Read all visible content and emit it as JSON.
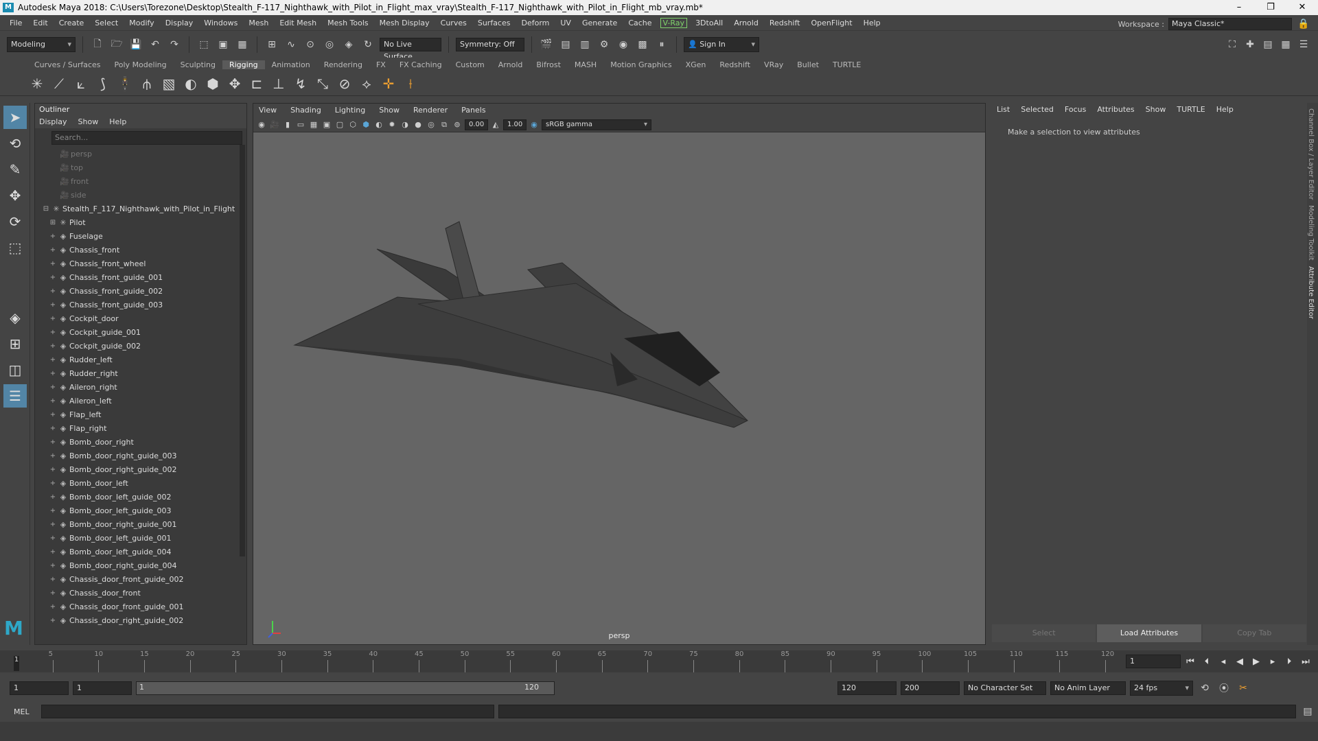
{
  "window": {
    "title": "Autodesk Maya 2018: C:\\Users\\Torezone\\Desktop\\Stealth_F-117_Nighthawk_with_Pilot_in_Flight_max_vray\\Stealth_F-117_Nighthawk_with_Pilot_in_Flight_mb_vray.mb*",
    "controls": [
      "–",
      "❐",
      "✕"
    ]
  },
  "menubar": [
    "File",
    "Edit",
    "Create",
    "Select",
    "Modify",
    "Display",
    "Windows",
    "Mesh",
    "Edit Mesh",
    "Mesh Tools",
    "Mesh Display",
    "Curves",
    "Surfaces",
    "Deform",
    "UV",
    "Generate",
    "Cache"
  ],
  "menubar_vray": "V-Ray",
  "menubar_tail": [
    "3DtoAll",
    "Arnold",
    "Redshift",
    "OpenFlight",
    "Help"
  ],
  "workspace": {
    "label": "Workspace :",
    "value": "Maya Classic*"
  },
  "statusline": {
    "mode": "Modeling",
    "live_surface": "No Live Surface",
    "symmetry": "Symmetry: Off",
    "sign_in": "Sign In"
  },
  "shelf_tabs": [
    "Curves / Surfaces",
    "Poly Modeling",
    "Sculpting",
    "Rigging",
    "Animation",
    "Rendering",
    "FX",
    "FX Caching",
    "Custom",
    "Arnold",
    "Bifrost",
    "MASH",
    "Motion Graphics",
    "XGen",
    "Redshift",
    "VRay",
    "Bullet",
    "TURTLE"
  ],
  "shelf_active": "Rigging",
  "outliner": {
    "title": "Outliner",
    "menu": [
      "Display",
      "Show",
      "Help"
    ],
    "search_placeholder": "Search...",
    "cameras": [
      "persp",
      "top",
      "front",
      "side"
    ],
    "root": "Stealth_F_117_Nighthawk_with_Pilot_in_Flight",
    "pilot": "Pilot",
    "items": [
      "Fuselage",
      "Chassis_front",
      "Chassis_front_wheel",
      "Chassis_front_guide_001",
      "Chassis_front_guide_002",
      "Chassis_front_guide_003",
      "Cockpit_door",
      "Cockpit_guide_001",
      "Cockpit_guide_002",
      "Rudder_left",
      "Rudder_right",
      "Aileron_right",
      "Aileron_left",
      "Flap_left",
      "Flap_right",
      "Bomb_door_right",
      "Bomb_door_right_guide_003",
      "Bomb_door_right_guide_002",
      "Bomb_door_left",
      "Bomb_door_left_guide_002",
      "Bomb_door_left_guide_003",
      "Bomb_door_right_guide_001",
      "Bomb_door_left_guide_001",
      "Bomb_door_left_guide_004",
      "Bomb_door_right_guide_004",
      "Chassis_door_front_guide_002",
      "Chassis_door_front",
      "Chassis_door_front_guide_001",
      "Chassis_door_right_guide_002"
    ]
  },
  "viewport": {
    "menu": [
      "View",
      "Shading",
      "Lighting",
      "Show",
      "Renderer",
      "Panels"
    ],
    "exposure": "0.00",
    "gamma": "1.00",
    "colorspace": "sRGB gamma",
    "camera_label": "persp"
  },
  "attribute_editor": {
    "menu": [
      "List",
      "Selected",
      "Focus",
      "Attributes",
      "Show",
      "TURTLE",
      "Help"
    ],
    "message": "Make a selection to view attributes",
    "buttons": [
      "Select",
      "Load Attributes",
      "Copy Tab"
    ]
  },
  "side_tabs": [
    "Channel Box / Layer Editor",
    "Modeling Toolkit",
    "Attribute Editor"
  ],
  "timeline": {
    "ticks": [
      "5",
      "10",
      "15",
      "20",
      "25",
      "30",
      "35",
      "40",
      "45",
      "50",
      "55",
      "60",
      "65",
      "70",
      "75",
      "80",
      "85",
      "90",
      "95",
      "100",
      "105",
      "110",
      "115",
      "120"
    ],
    "current_frame": "1",
    "start_marker": "1"
  },
  "range": {
    "start": "1",
    "playback_start": "1",
    "slider_start": "1",
    "slider_end": "120",
    "playback_end": "120",
    "end": "200",
    "character_set": "No Character Set",
    "anim_layer": "No Anim Layer",
    "fps": "24 fps"
  },
  "cmdline": {
    "label": "MEL"
  }
}
